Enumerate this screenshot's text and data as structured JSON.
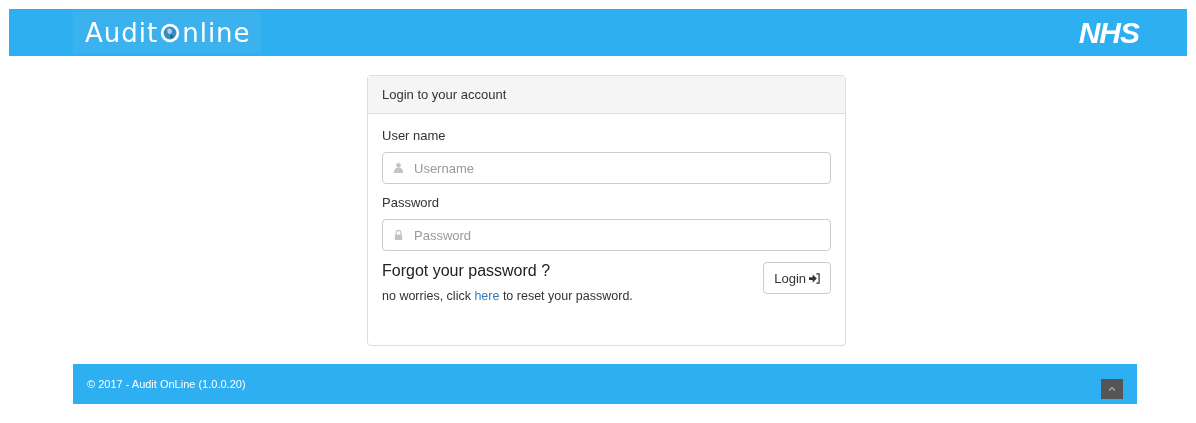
{
  "header": {
    "logo": {
      "before": "Audit",
      "after": "nline"
    },
    "brand": "NHS"
  },
  "login_panel": {
    "title": "Login to your account",
    "fields": [
      {
        "label": "User name",
        "placeholder": "Username",
        "kind": "user"
      },
      {
        "label": "Password",
        "placeholder": "Password",
        "kind": "lock"
      }
    ],
    "forgot_heading": "Forgot your password ?",
    "forgot_text": {
      "before": "no worries, click",
      "link": "here",
      "after": "to reset your password."
    },
    "login_button": "Login"
  },
  "footer": {
    "text": "© 2017 - Audit OnLine (1.0.0.20)"
  }
}
